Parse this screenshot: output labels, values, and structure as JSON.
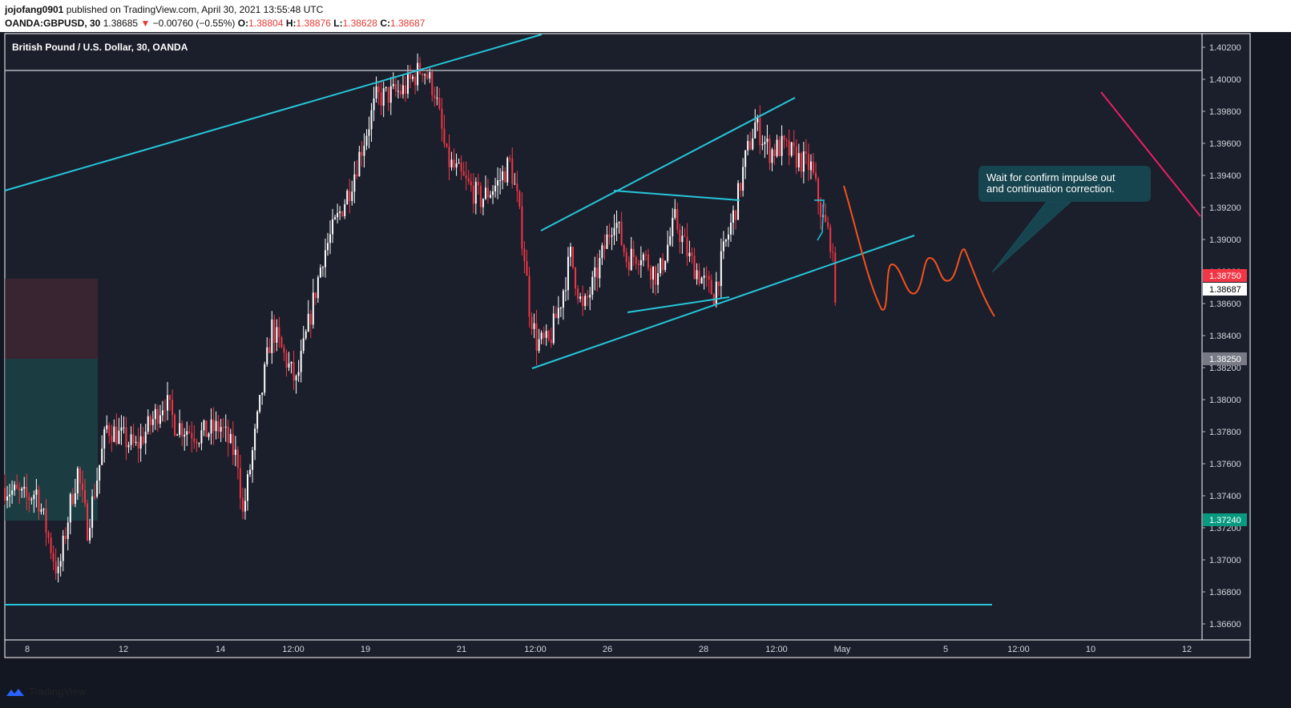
{
  "header": {
    "author": "jojofang0901",
    "published": "published on TradingView.com, April 30, 2021 13:55:48 UTC",
    "symbol": "OANDA:GBPUSD, 30",
    "last": "1.38685",
    "change_arrow": "▼",
    "change": "−0.00760 (−0.55%)",
    "o_label": "O:",
    "o": "1.38804",
    "h_label": "H:",
    "h": "1.38876",
    "l_label": "L:",
    "l": "1.38628",
    "c_label": "C:",
    "c": "1.38687"
  },
  "brand": "TradingView",
  "chart_data": {
    "type": "candlestick",
    "title": "British Pound / U.S. Dollar, 30, OANDA",
    "ylim": [
      1.365,
      1.403
    ],
    "y_ticks": [
      "1.40200",
      "1.40000",
      "1.39800",
      "1.39600",
      "1.39400",
      "1.39200",
      "1.39000",
      "1.38800",
      "1.38600",
      "1.38400",
      "1.38200",
      "1.38000",
      "1.37800",
      "1.37600",
      "1.37400",
      "1.37200",
      "1.37000",
      "1.36800",
      "1.36600"
    ],
    "x_ticks": [
      "8",
      "12",
      "14",
      "12:00",
      "19",
      "21",
      "12:00",
      "26",
      "28",
      "12:00",
      "May",
      "5",
      "12:00",
      "10",
      "12"
    ],
    "price_labels": [
      {
        "value": "1.38750",
        "color": "#f23645"
      },
      {
        "value": "1.38687",
        "color": "#ffffff"
      },
      {
        "value": "1.38250",
        "color": "#787b86"
      },
      {
        "value": "1.37240",
        "color": "#089981"
      }
    ],
    "price_path": [
      [
        0,
        1.3745
      ],
      [
        9,
        1.3738
      ],
      [
        13,
        1.3743
      ],
      [
        22,
        1.369
      ],
      [
        27,
        1.3735
      ],
      [
        30,
        1.3755
      ],
      [
        34,
        1.372
      ],
      [
        42,
        1.3783
      ],
      [
        54,
        1.377
      ],
      [
        66,
        1.38
      ],
      [
        70,
        1.3785
      ],
      [
        80,
        1.3778
      ],
      [
        89,
        1.3783
      ],
      [
        96,
        1.3762
      ],
      [
        98,
        1.3728
      ],
      [
        110,
        1.3845
      ],
      [
        120,
        1.381
      ],
      [
        131,
        1.389
      ],
      [
        142,
        1.3932
      ],
      [
        153,
        1.3988
      ],
      [
        164,
        1.3993
      ],
      [
        172,
        1.4008
      ],
      [
        177,
        1.3993
      ],
      [
        182,
        1.395
      ],
      [
        190,
        1.3935
      ],
      [
        196,
        1.3925
      ],
      [
        203,
        1.3935
      ],
      [
        208,
        1.3948
      ],
      [
        211,
        1.3925
      ],
      [
        214,
        1.389
      ],
      [
        216,
        1.3858
      ],
      [
        219,
        1.3836
      ],
      [
        224,
        1.3835
      ],
      [
        229,
        1.3862
      ],
      [
        233,
        1.389
      ],
      [
        238,
        1.3855
      ],
      [
        243,
        1.3875
      ],
      [
        251,
        1.3915
      ],
      [
        256,
        1.3888
      ],
      [
        262,
        1.3892
      ],
      [
        269,
        1.3876
      ],
      [
        276,
        1.3912
      ],
      [
        282,
        1.3888
      ],
      [
        288,
        1.3873
      ],
      [
        292,
        1.3866
      ],
      [
        297,
        1.3898
      ],
      [
        301,
        1.392
      ],
      [
        305,
        1.395
      ],
      [
        309,
        1.3972
      ],
      [
        315,
        1.3955
      ],
      [
        320,
        1.3958
      ],
      [
        327,
        1.395
      ],
      [
        332,
        1.3945
      ],
      [
        337,
        1.3912
      ],
      [
        340,
        1.39
      ],
      [
        342,
        1.3868
      ]
    ],
    "annotation": "Wait for confirm impulse out\nand continuation correction.",
    "colors": {
      "up": "#ffffff",
      "down": "#f23645",
      "trend": "#26c6da",
      "projection": "#f4511e",
      "entry": "#f23645"
    }
  }
}
